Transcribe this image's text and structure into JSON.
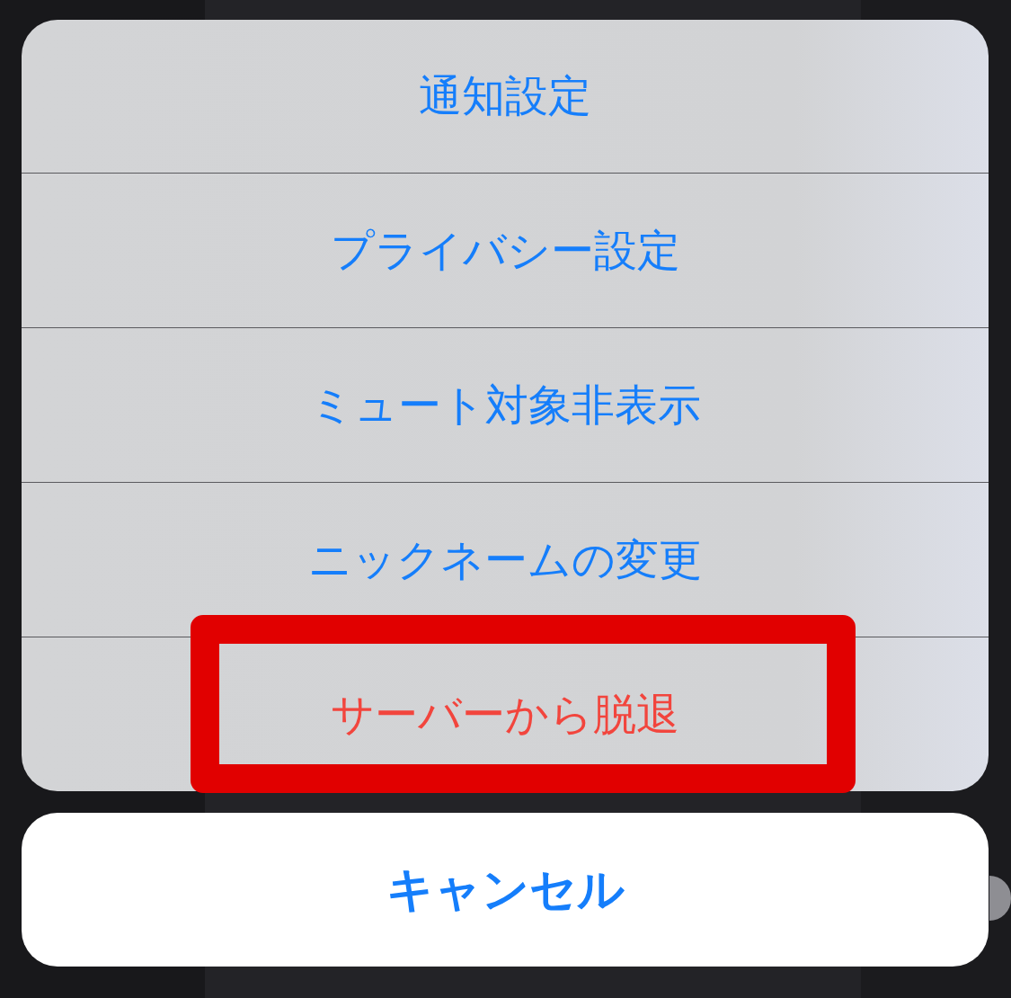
{
  "action_sheet": {
    "items": [
      {
        "label": "通知設定",
        "kind": "default",
        "highlighted": false
      },
      {
        "label": "プライバシー設定",
        "kind": "default",
        "highlighted": false
      },
      {
        "label": "ミュート対象非表示",
        "kind": "default",
        "highlighted": false
      },
      {
        "label": "ニックネームの変更",
        "kind": "default",
        "highlighted": false
      },
      {
        "label": "サーバーから脱退",
        "kind": "destructive",
        "highlighted": true
      }
    ]
  },
  "cancel_button": {
    "label": "キャンセル"
  }
}
